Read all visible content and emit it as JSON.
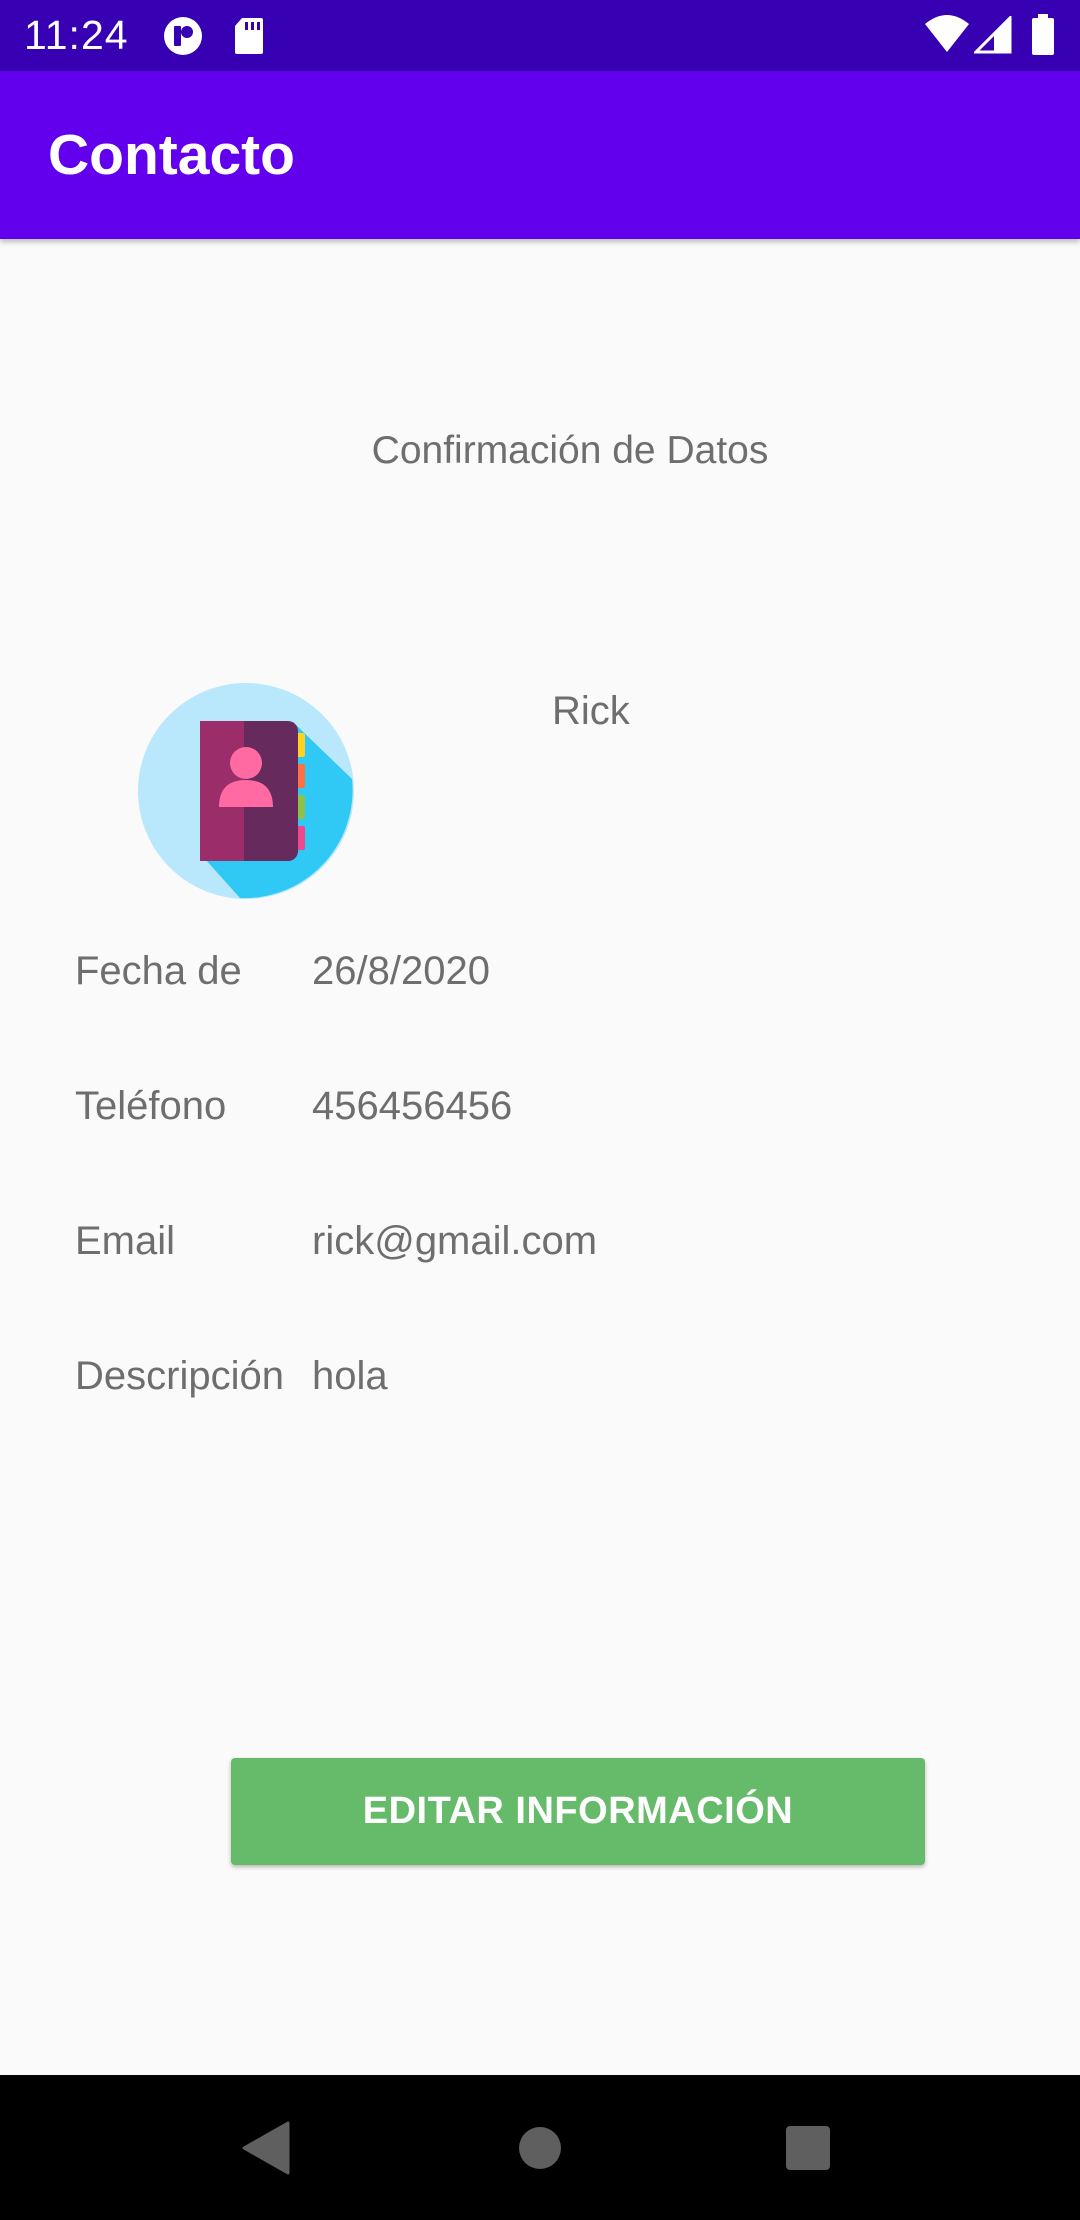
{
  "status_bar": {
    "time": "11:24",
    "icons": [
      "notification-app-icon",
      "sd-card-icon",
      "wifi-icon",
      "cellular-signal-icon",
      "battery-icon"
    ]
  },
  "app_bar": {
    "title": "Contacto",
    "color": "#6200EE"
  },
  "main": {
    "subtitle": "Confirmación de Datos",
    "avatar_icon": "contact-book-icon",
    "name": "Rick",
    "fields": [
      {
        "label": "Fecha de",
        "value": "26/8/2020"
      },
      {
        "label": "Teléfono",
        "value": "456456456"
      },
      {
        "label": "Email",
        "value": "rick@gmail.com"
      },
      {
        "label": "Descripción",
        "value": "hola"
      }
    ],
    "edit_button": {
      "label": "EDITAR INFORMACIÓN",
      "color": "#66BB6A"
    }
  },
  "nav_bar": {
    "icons": [
      "back-icon",
      "home-icon",
      "recents-icon"
    ]
  }
}
